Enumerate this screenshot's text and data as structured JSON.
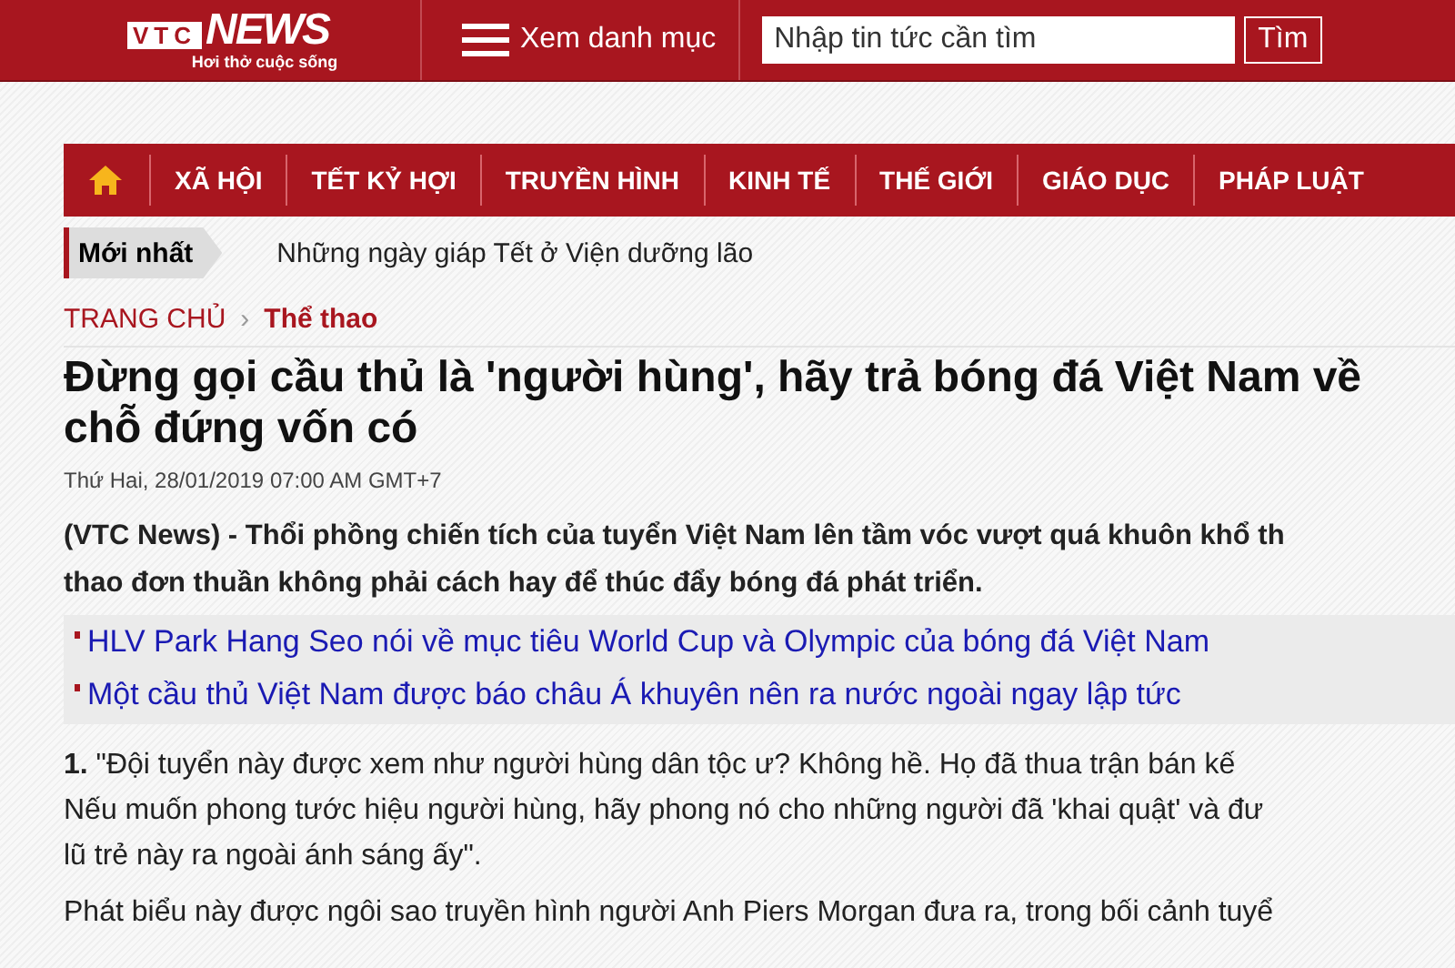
{
  "header": {
    "logo": {
      "brand_left": "VTC",
      "brand_right": "NEWS",
      "slogan": "Hơi thở cuộc sống"
    },
    "menu_label": "Xem danh mục",
    "search": {
      "placeholder": "Nhập tin tức cần tìm"
    },
    "search_button": "Tìm"
  },
  "nav": {
    "items": [
      {
        "kind": "home"
      },
      {
        "kind": "text",
        "label": "XÃ HỘI"
      },
      {
        "kind": "text",
        "label": "TẾT KỶ HỢI"
      },
      {
        "kind": "text",
        "label": "TRUYỀN HÌNH"
      },
      {
        "kind": "text",
        "label": "KINH TẾ"
      },
      {
        "kind": "text",
        "label": "THẾ GIỚI"
      },
      {
        "kind": "text",
        "label": "GIÁO DỤC"
      },
      {
        "kind": "text",
        "label": "PHÁP LUẬT"
      }
    ]
  },
  "latest": {
    "label": "Mới nhất",
    "headline": "Những ngày giáp Tết ở Viện dưỡng lão"
  },
  "breadcrumb": {
    "items": [
      "TRANG CHỦ",
      "Thể thao"
    ],
    "separator": "›"
  },
  "article": {
    "title": "Đừng gọi cầu thủ là 'người hùng', hãy trả bóng đá Việt Nam về chỗ đứng vốn có",
    "date": "Thứ Hai, 28/01/2019 07:00 AM GMT+7",
    "lead_lines": [
      "(VTC News) - Thổi phồng chiến tích của tuyển Việt Nam lên tầm vóc vượt quá khuôn khổ th",
      "thao đơn thuần không phải cách hay để thúc đẩy bóng đá phát triển."
    ],
    "related": [
      "HLV Park Hang Seo nói về mục tiêu World Cup và Olympic của bóng đá Việt Nam",
      "Một cầu thủ Việt Nam được báo châu Á khuyên nên ra nước ngoài ngay lập tức"
    ],
    "paragraphs": [
      {
        "lines": [
          "**1.** \"Đội tuyển này được xem như người hùng dân tộc ư? Không hề. Họ đã thua trận bán kế",
          "Nếu muốn phong tước hiệu người hùng, hãy phong nó cho những người đã 'khai quật' và đư",
          "lũ trẻ này ra ngoài ánh sáng ấy\"."
        ]
      },
      {
        "lines": [
          "Phát biểu này được ngôi sao truyền hình người Anh Piers Morgan đưa ra, trong bối cảnh tuyể"
        ]
      }
    ]
  }
}
